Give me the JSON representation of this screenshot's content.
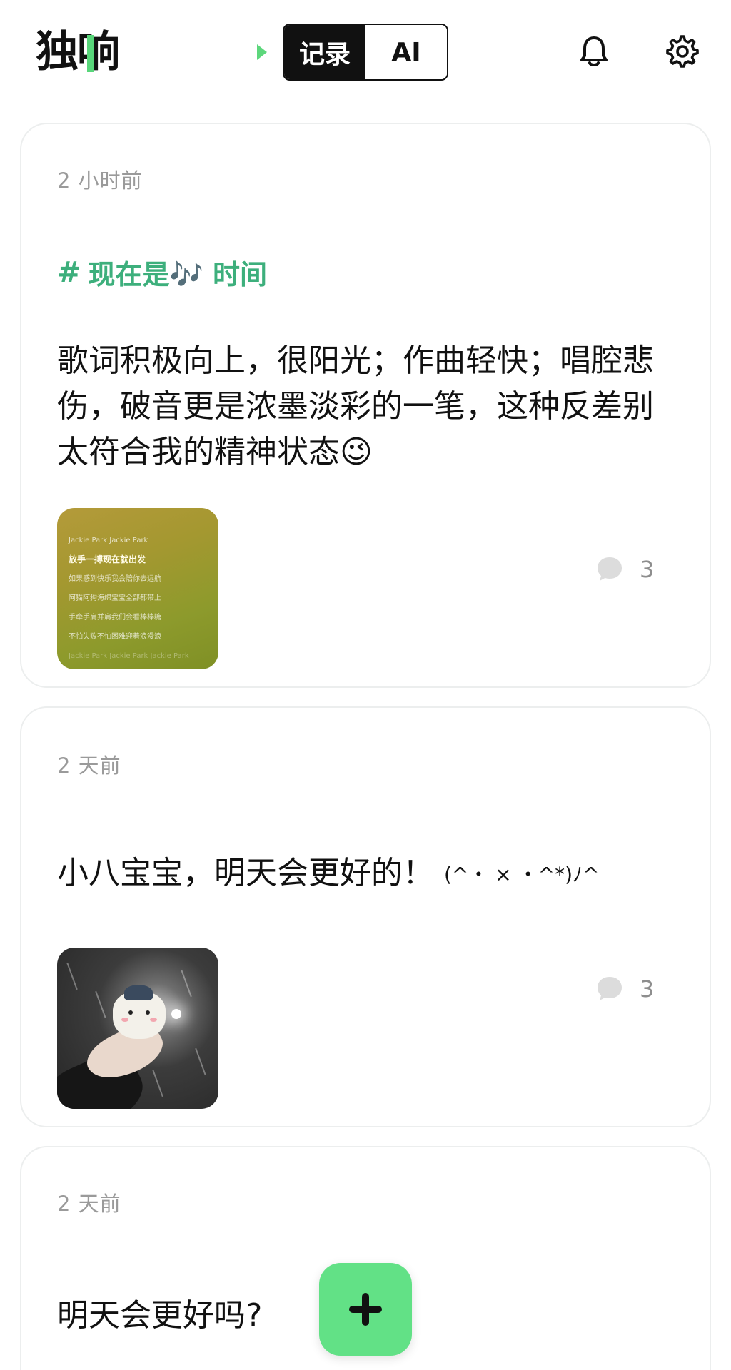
{
  "header": {
    "logo_char_1": "独",
    "logo_char_2": "响",
    "mode_tabs": [
      {
        "label": "记录",
        "active": true
      },
      {
        "label": "AI",
        "active": false
      }
    ],
    "icons": {
      "notifications": "bell-icon",
      "settings": "gear-icon"
    }
  },
  "posts": [
    {
      "time": "2 小时前",
      "topic": "现在是🎶 时间",
      "text": "歌词积极向上，很阳光；作曲轻快；唱腔悲伤，破音更是浓墨淡彩的一笔，这种反差别太符合我的精神状态😉",
      "image": {
        "lines": [
          "Jackie Park Jackie Park",
          "放手一搏现在就出发",
          "如果感到快乐我会陪你去远航",
          "阿猫阿狗海绵宝宝全部都带上",
          "手牵手肩并肩我们会看棒棒糖",
          "不怕失败不怕困难迎着浪漫浪",
          "Jackie Park Jackie Park Jackie Park"
        ]
      },
      "comment_count": "3"
    },
    {
      "time": "2 天前",
      "text": "小八宝宝，明天会更好的！",
      "kaomoji": "(^・ × ・^*)ﾉ^",
      "comment_count": "3"
    },
    {
      "time": "2 天前",
      "text": "明天会更好吗?"
    }
  ],
  "colors": {
    "accent_green": "#62e186",
    "topic_green": "#3daf7c",
    "muted_text": "#9a9a9a"
  },
  "fab": {
    "icon": "plus-icon"
  }
}
